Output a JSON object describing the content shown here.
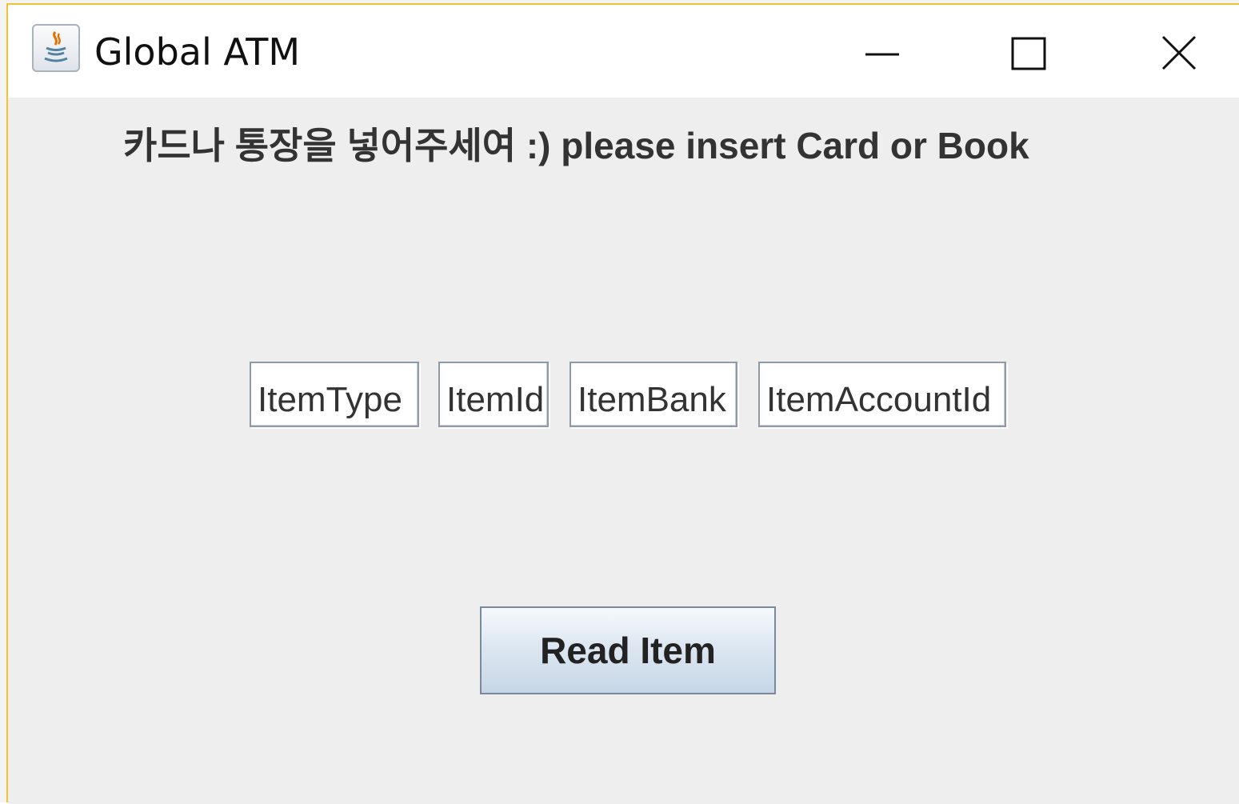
{
  "window": {
    "title": "Global ATM"
  },
  "main": {
    "message": "카드나 통장을 넣어주세여 :) please insert Card or Book",
    "fields": [
      {
        "value": "ItemType"
      },
      {
        "value": "ItemId"
      },
      {
        "value": "ItemBank"
      },
      {
        "value": "ItemAccountId"
      }
    ],
    "read_button_label": "Read Item"
  },
  "icons": {
    "app": "java-icon",
    "minimize": "minimize-icon",
    "maximize": "maximize-icon",
    "close": "close-icon"
  },
  "colors": {
    "window_border": "#f2c230",
    "content_bg": "#eeeeee",
    "text": "#333333"
  }
}
